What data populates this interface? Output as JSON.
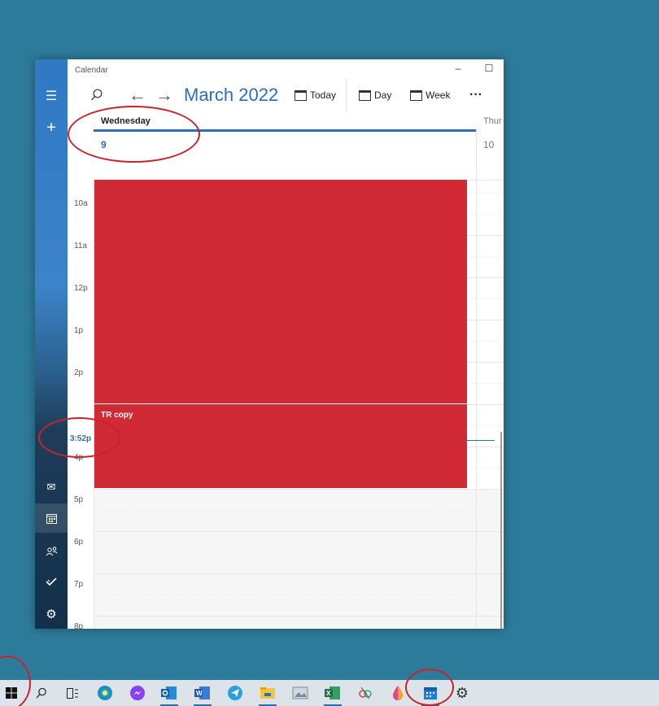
{
  "window": {
    "title": "Calendar",
    "controls": {
      "minimize": "–",
      "maximize": "☐",
      "close": "✕"
    }
  },
  "toolbar": {
    "month": "March 2022",
    "today_label": "Today",
    "day_label": "Day",
    "week_label": "Week",
    "more_label": "···"
  },
  "day_header": {
    "day_name": "Wednesday",
    "day_number": "9",
    "next_day_name": "Thur",
    "next_day_number": "10"
  },
  "hours": [
    "10a",
    "11a",
    "12p",
    "1p",
    "2p",
    "4p",
    "5p",
    "6p",
    "7p",
    "8p"
  ],
  "current_time": "3:52p",
  "events": [
    {
      "title": ""
    },
    {
      "title": "TR copy"
    }
  ],
  "colors": {
    "accent": "#2a6fb7",
    "event": "#cf2a36",
    "desktop": "#2d7b9a",
    "annotation": "#c8232c"
  }
}
